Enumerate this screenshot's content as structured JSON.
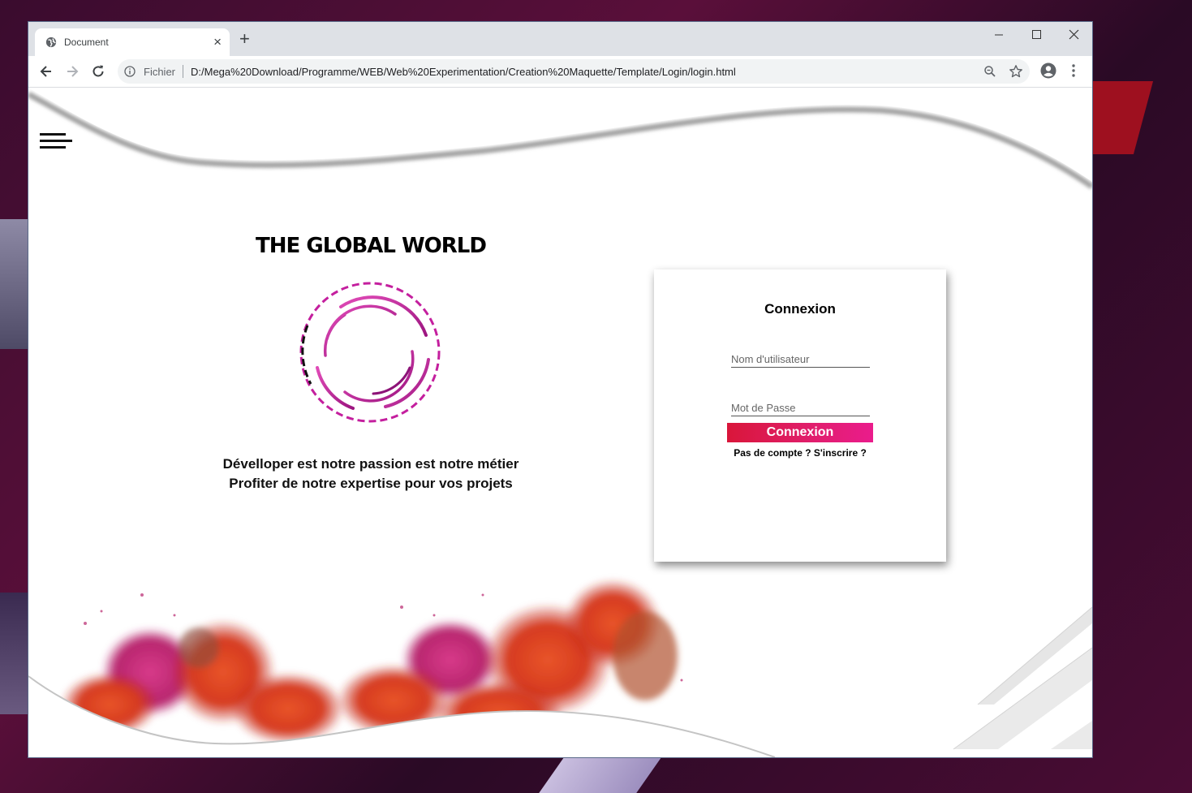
{
  "browser": {
    "tab_title": "Document",
    "new_tab_symbol": "+",
    "close_symbol": "×",
    "security_label": "Fichier",
    "url": "D:/Mega%20Download/Programme/WEB/Web%20Experimentation/Creation%20Maquette/Template/Login/login.html"
  },
  "page": {
    "brand": "THE GLOBAL WORLD",
    "tagline_line1": "Dévelloper est notre passion est notre métier",
    "tagline_line2": "Profiter de notre expertise pour vos projets"
  },
  "login": {
    "title": "Connexion",
    "username_placeholder": "Nom d'utilisateur",
    "password_placeholder": "Mot de Passe",
    "submit_label": "Connexion",
    "signup_prefix": "Pas de compte ? ",
    "signup_link": "S'inscrire ?"
  },
  "colors": {
    "accent_start": "#d9163a",
    "accent_end": "#ea1c8c",
    "logo_magenta": "#c41f9e"
  },
  "icons": [
    "globe-icon",
    "close-icon",
    "plus-icon",
    "minimize-icon",
    "maximize-icon",
    "window-close-icon",
    "back-icon",
    "forward-icon",
    "reload-icon",
    "info-icon",
    "zoom-icon",
    "star-icon",
    "account-icon",
    "kebab-menu-icon",
    "hamburger-icon"
  ]
}
